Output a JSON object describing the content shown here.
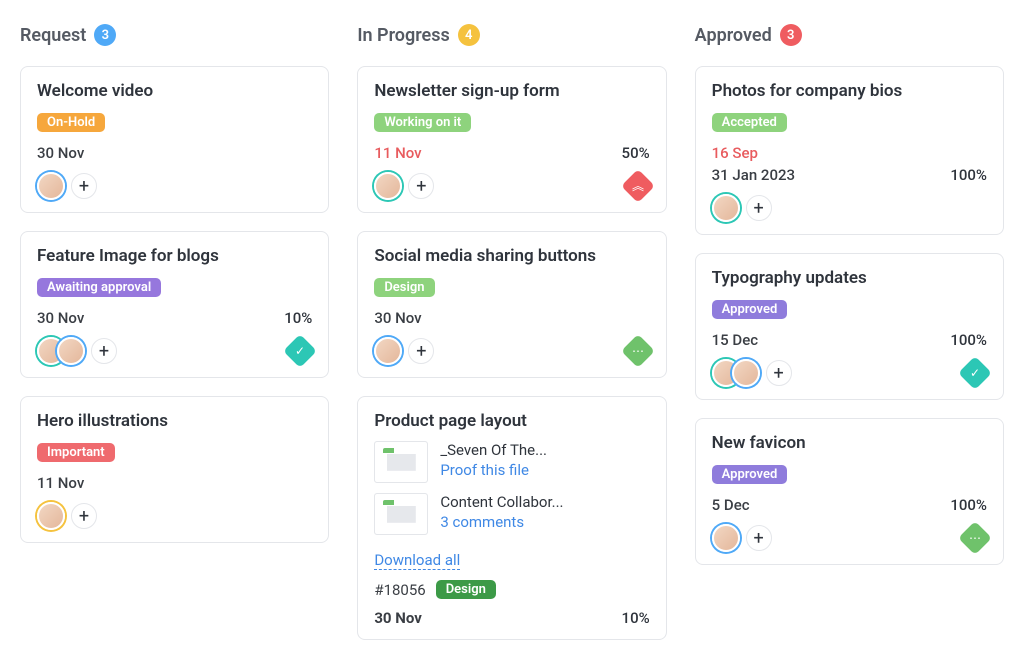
{
  "columns": [
    {
      "title": "Request",
      "count": "3",
      "count_color": "count-blue",
      "cards": [
        {
          "title": "Welcome video",
          "tag": "On-Hold",
          "tag_color": "tag-orange",
          "date": "30 Nov",
          "avatars": [
            "ring-blue"
          ]
        },
        {
          "title": "Feature Image for blogs",
          "tag": "Awaiting approval",
          "tag_color": "tag-purple",
          "date": "30 Nov",
          "percent": "10%",
          "avatars": [
            "ring-teal",
            "ring-blue"
          ],
          "priority": "pri-teal",
          "priority_glyph": "✓"
        },
        {
          "title": "Hero illustrations",
          "tag": "Important",
          "tag_color": "tag-red",
          "date": "11 Nov",
          "avatars": [
            "ring-yellow"
          ]
        }
      ]
    },
    {
      "title": "In Progress",
      "count": "4",
      "count_color": "count-yellow",
      "cards": [
        {
          "title": "Newsletter sign-up form",
          "tag": "Working on it",
          "tag_color": "tag-green",
          "date": "11 Nov",
          "date_overdue": true,
          "percent": "50%",
          "avatars": [
            "ring-teal"
          ],
          "priority": "pri-red",
          "priority_glyph": "︽"
        },
        {
          "title": "Social media sharing buttons",
          "tag": "Design",
          "tag_color": "tag-green",
          "date": "30 Nov",
          "avatars": [
            "ring-blue"
          ],
          "priority": "pri-green",
          "priority_glyph": "⋯"
        },
        {
          "title": "Product page layout",
          "attachments": [
            {
              "name": "_Seven Of The...",
              "action": "Proof this file"
            },
            {
              "name": "Content Collabor...",
              "action": "3 comments"
            }
          ],
          "download_label": "Download all",
          "id": "#18056",
          "tag": "Design",
          "tag_color": "tag-darkgreen",
          "date": "30 Nov",
          "percent": "10%"
        }
      ]
    },
    {
      "title": "Approved",
      "count": "3",
      "count_color": "count-red",
      "cards": [
        {
          "title": "Photos for company bios",
          "tag": "Accepted",
          "tag_color": "tag-green",
          "date": "16 Sep",
          "date_overdue": true,
          "date2": "31 Jan 2023",
          "percent": "100%",
          "avatars": [
            "ring-teal"
          ]
        },
        {
          "title": "Typography updates",
          "tag": "Approved",
          "tag_color": "tag-violet",
          "date": "15 Dec",
          "percent": "100%",
          "avatars": [
            "ring-teal",
            "ring-blue"
          ],
          "priority": "pri-teal",
          "priority_glyph": "✓"
        },
        {
          "title": "New favicon",
          "tag": "Approved",
          "tag_color": "tag-violet",
          "date": "5 Dec",
          "percent": "100%",
          "avatars": [
            "ring-blue"
          ],
          "priority": "pri-green",
          "priority_glyph": "⋯"
        }
      ]
    }
  ]
}
